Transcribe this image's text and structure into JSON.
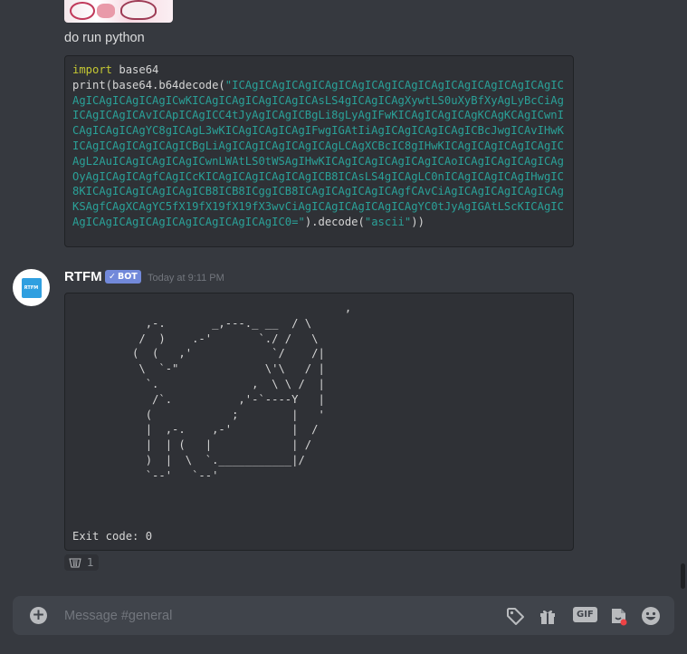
{
  "previous_message": {
    "text": "do run python",
    "code": {
      "keyword": "import",
      "module": " base64",
      "line2_prefix": "print(base64.b64decode(",
      "encoded_string": "\"ICAgICAgICAgICAgICAgICAgICAgICAgICAgICAgICAgICAgICAgICAgICAgICAgICwKICAgICAgICAgICAgICAsLS4gICAgICAgXywtLS0uXyBfXyAgLyBcCiAgICAgICAgICAvICApICAgICC4tJyAgICAgICBgLi8gLyAgIFwKICAgICAgICAgKCAgKCAgICwnICAgICAgICAgYC8gICAgL3wKICAgICAgICAgIFwgIGAtIiAgICAgICAgICAgICBcJwgICAvIHwKICAgICAgICAgICAgICBgLiAgICAgICAgICAgICAgLCAgXCBcIC8gIHwKICAgICAgICAgICAgICAgL2AuICAgICAgICAgICwnLWAtLS0tWSAgIHwKICAgICAgICAgICAgICAoICAgICAgICAgICAgOyAgICAgICAgfCAgICcKICAgICAgICAgICAgICB8ICAsLS4gICAgLC0nICAgICAgICAgIHwgIC8KICAgICAgICAgICAgICB8ICB8ICggICB8ICAgICAgICAgICAgfCAvCiAgICAgICAgICAgICAgKSAgfCAgXCAgYC5fX19fX19fX19fX3wvCiAgICAgICAgICAgICAgYC0tJyAgIGAtLScKICAgICAgICAgICAgICAgICAgICAgICAgICAgIC0=\"",
      "line2_suffix_a": ").decode(",
      "arg": "\"ascii\"",
      "line2_suffix_b": "))"
    }
  },
  "bot_message": {
    "username": "RTFM",
    "bot_tag": "BOT",
    "avatar_text": "RTFM",
    "timestamp": "Today at 9:11 PM",
    "output_art": "                                         ,\n           ,-.       _,---._ __  / \\\n          /  )    .-'       `./ /   \\\n         (  (   ,'            `/    /|\n          \\  `-\"             \\'\\   / |\n           `.              ,  \\ \\ /  |\n            /`.          ,'-`----Y   |\n           (            ;        |   '\n           |  ,-.    ,-'         |  /\n           |  | (   |            | /\n           )  |  \\  `.___________|/\n           `--'   `--'",
    "exit_text": "Exit code: 0",
    "reaction_count": "1"
  },
  "composer": {
    "placeholder": "Message #general",
    "gif_label": "GIF"
  }
}
